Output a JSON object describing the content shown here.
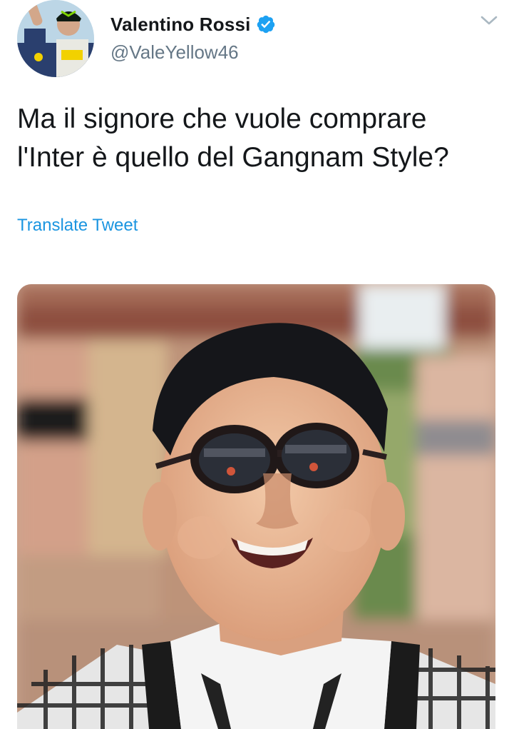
{
  "author": {
    "display_name": "Valentino Rossi",
    "handle": "@ValeYellow46",
    "verified": true,
    "avatar_icon": "profile-photo-avatar",
    "verified_icon": "verified-badge-icon",
    "verified_color": "#1da1f2"
  },
  "tweet": {
    "text": "Ma il signore che vuole comprare\nl'Inter è quello del Gangnam Style?",
    "translate_label": "Translate Tweet",
    "menu_icon": "chevron-down-icon"
  },
  "media": {
    "type": "photo"
  },
  "colors": {
    "text": "#14171a",
    "secondary": "#657786",
    "link": "#1b95e0"
  }
}
